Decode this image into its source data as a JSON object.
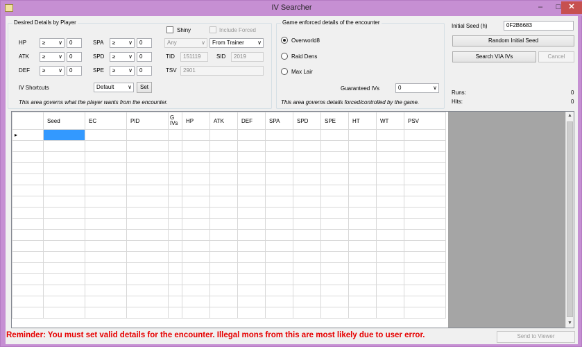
{
  "window": {
    "title": "IV Searcher",
    "minimize": "–",
    "maximize": "□",
    "close": "✕"
  },
  "player": {
    "group_label": "Desired Details by Player",
    "stats": [
      {
        "name": "HP",
        "op": "≥",
        "value": "0"
      },
      {
        "name": "ATK",
        "op": "≥",
        "value": "0"
      },
      {
        "name": "DEF",
        "op": "≥",
        "value": "0"
      },
      {
        "name": "SPA",
        "op": "≥",
        "value": "0"
      },
      {
        "name": "SPD",
        "op": "≥",
        "value": "0"
      },
      {
        "name": "SPE",
        "op": "≥",
        "value": "0"
      }
    ],
    "shiny_label": "Shiny",
    "shiny_type": "Any",
    "include_forced_label": "Include Forced",
    "source": "From Trainer",
    "tid_label": "TID",
    "tid_value": "151119",
    "sid_label": "SID",
    "sid_value": "2019",
    "tsv_label": "TSV",
    "tsv_value": "2901",
    "shortcuts_label": "IV Shortcuts",
    "shortcut_value": "Default",
    "set_button": "Set",
    "footnote": "This area governs what the player wants from the encounter."
  },
  "game": {
    "group_label": "Game enforced details of the encounter",
    "radios": [
      "Overworld8",
      "Raid Dens",
      "Max Lair"
    ],
    "selected": 0,
    "guaranteed_label": "Guaranteed IVs",
    "guaranteed_value": "0",
    "footnote": "This area governs details forced/controlled by the game."
  },
  "search": {
    "seed_label": "Initial Seed (h)",
    "seed_value": "0F2B6683",
    "random_button": "Random Initial Seed",
    "search_button": "Search VIA IVs",
    "cancel_button": "Cancel",
    "runs_label": "Runs:",
    "runs_value": "0",
    "hits_label": "Hits:",
    "hits_value": "0"
  },
  "grid": {
    "columns": [
      "Seed",
      "EC",
      "PID",
      "G IVs",
      "HP",
      "ATK",
      "DEF",
      "SPA",
      "SPD",
      "SPE",
      "HT",
      "WT",
      "PSV"
    ],
    "row_marker": "▸",
    "scroll_up": "▲",
    "scroll_down": "▼"
  },
  "footer": {
    "reminder": "Reminder: You must set valid details for the encounter. Illegal mons from this are most likely due to user error.",
    "send_button": "Send to Viewer"
  },
  "colors": {
    "titlebar": "#c68fd3",
    "close": "#c75050",
    "reminder": "#e60000",
    "selection": "#3399ff"
  }
}
